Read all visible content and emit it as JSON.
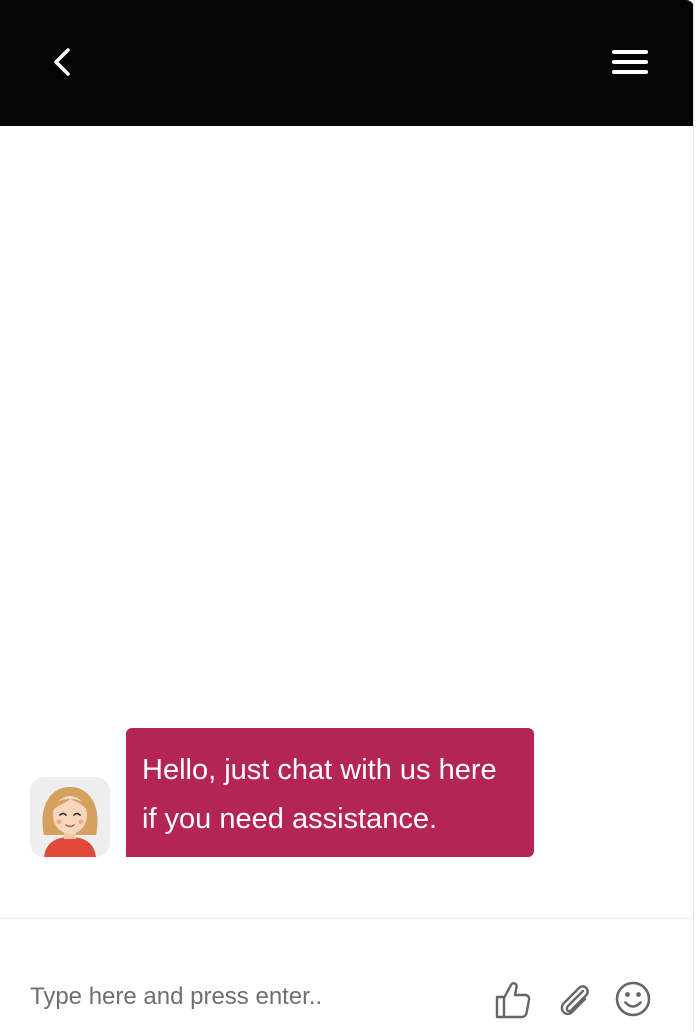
{
  "header": {
    "back_icon": "chevron-left-icon",
    "menu_icon": "hamburger-menu-icon",
    "background": "#050505"
  },
  "conversation": {
    "messages": [
      {
        "sender": "agent",
        "avatar_icon": "agent-avatar-icon",
        "text": "Hello, just chat with us here if you need assistance.",
        "bubble_color": "#b52551"
      }
    ]
  },
  "composer": {
    "placeholder": "Type here and press enter..",
    "value": "",
    "actions": [
      {
        "icon": "thumbs-up-icon"
      },
      {
        "icon": "paperclip-icon"
      },
      {
        "icon": "smiley-icon"
      }
    ]
  }
}
